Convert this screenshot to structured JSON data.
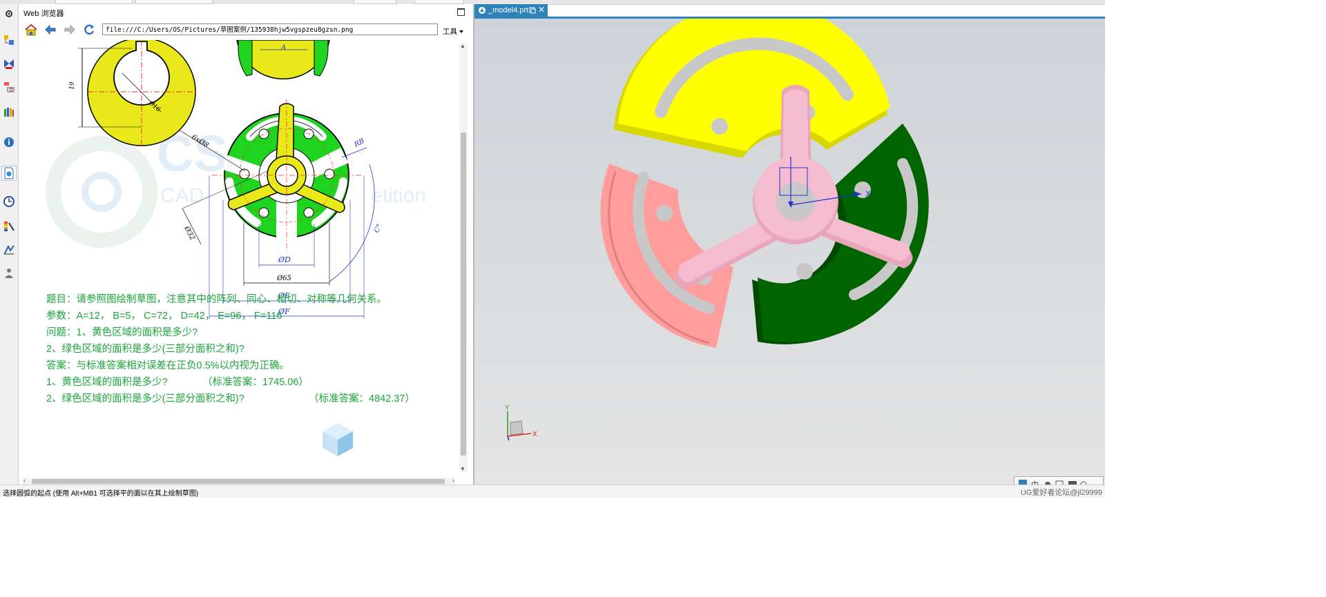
{
  "browser": {
    "title": "Web 浏览器",
    "url": "file:///C:/Users/OS/Pictures/草图案例/135938hjw5vgspzeu8gzsn.png",
    "tools_label": "工具"
  },
  "drawing": {
    "labels": {
      "dim_a": "A",
      "dim_19": "19",
      "dia_16": "Ø16",
      "holes": "6xØ8",
      "rb": "RB",
      "angle_c": "C°",
      "dia_32": "Ø32",
      "dia_d": "ØD",
      "dia_65": "Ø65",
      "dia_e": "ØE",
      "dia_f": "ØF"
    },
    "watermark": {
      "big": "CSCs",
      "sub": "CAD",
      "sub2": "etition"
    }
  },
  "problem": {
    "title_line": "题目：请参照图绘制草图，注意其中的阵列、同心、相切、对称等几何关系。",
    "params_line": "参数：A=12， B=5， C=72， D=42， E=96， F=116",
    "question_line": "问题：1、黄色区域的面积是多少?",
    "question2_line": "2、绿色区域的面积是多少(三部分面积之和)?",
    "answer_line": "答案：与标准答案相对误差在正负0.5%以内视为正确。",
    "answer1_q": "1、黄色区域的面积是多少?",
    "answer1_value": "（标准答案：1745.06）",
    "answer2_q": "2、绿色区域的面积是多少(三部分面积之和)?",
    "answer2_value": "（标准答案：4842.37）"
  },
  "viewport": {
    "tab_label": "_model4.prt",
    "axis_x": "X",
    "axis_y": "Y"
  },
  "status": {
    "message": "选择圆弧的起点 (使用 Alt+MB1 可选择平的面以在其上绘制草图)",
    "watermark": "UG爱好者论坛@jl29999"
  },
  "colors": {
    "yellow": "#ffff00",
    "green": "#006400",
    "pink_sector": "#ff9d9d",
    "hub_pink": "#f5bccf",
    "text_green": "#1aa63a",
    "tab_blue": "#2f83b8"
  }
}
